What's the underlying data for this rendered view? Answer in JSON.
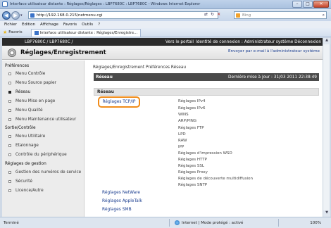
{
  "window": {
    "title": "Interface utilisateur distante : Réglages/Réglages : LBP7680C : LBP7680C - Windows Internet Explorer",
    "url": "http://192.168.0.215/netmenu.cgi",
    "search_placeholder": "Bing"
  },
  "menubar": [
    "Fichier",
    "Edition",
    "Affichage",
    "Favoris",
    "Outils",
    "?"
  ],
  "favorites": {
    "label": "Favoris",
    "tab_title": "Interface utilisateur distante : Réglages/Enregistre..."
  },
  "header": {
    "product": "LBP7680C / LBP7680C /",
    "portal_link": "Vers le portail",
    "identity": "Identité de connexion : Administrateur système Déconnexion"
  },
  "brand": {
    "title": "Réglages/Enregistrement",
    "email_link": "Envoyer par e-mail à l'administrateur système"
  },
  "sidebar": {
    "sections": [
      {
        "label": "Préférences",
        "items": [
          {
            "label": "Menu Contrôle",
            "active": false
          },
          {
            "label": "Menu Source papier",
            "active": false
          },
          {
            "label": "Réseau",
            "active": true
          },
          {
            "label": "Menu Mise en page",
            "active": false
          },
          {
            "label": "Menu Qualité",
            "active": false
          },
          {
            "label": "Menu Maintenance utilisateur",
            "active": false
          }
        ]
      },
      {
        "label": "Sortie/Contrôle",
        "items": [
          {
            "label": "Menu Utilitaire",
            "active": false
          },
          {
            "label": "Etalonnage",
            "active": false
          },
          {
            "label": "Contrôle du périphérique",
            "active": false
          }
        ]
      },
      {
        "label": "Réglages de gestion",
        "items": [
          {
            "label": "Gestion des numéros de service",
            "active": false
          },
          {
            "label": "Sécurité",
            "active": false
          },
          {
            "label": "Licence/Autre",
            "active": false
          }
        ]
      }
    ]
  },
  "main": {
    "breadcrumb": "Réglages/Enregistrement  Préférences  Réseau",
    "header_title": "Réseau",
    "last_update": "Dernière mise à jour : 31/03 2011 22:38:49",
    "section_title": "Réseau",
    "tcpip_link": "Réglages TCP/IP",
    "tcpip_subitems": [
      "Réglages IPv4",
      "Réglages IPv6",
      "WINS",
      "ARP/PING",
      "Réglages FTP",
      "LPD",
      "RAW",
      "IPP",
      "Réglages d'impression WSD",
      "Réglages HTTP",
      "Réglages SSL",
      "Réglages Proxy",
      "Réglages de découverte multidiffusion",
      "Réglages SNTP"
    ],
    "other_links": [
      "Réglages NetWare",
      "Réglages AppleTalk",
      "Réglages SMB"
    ]
  },
  "statusbar": {
    "left": "Terminé",
    "zone": "Internet | Mode protégé : activé",
    "zoom": "100%"
  }
}
